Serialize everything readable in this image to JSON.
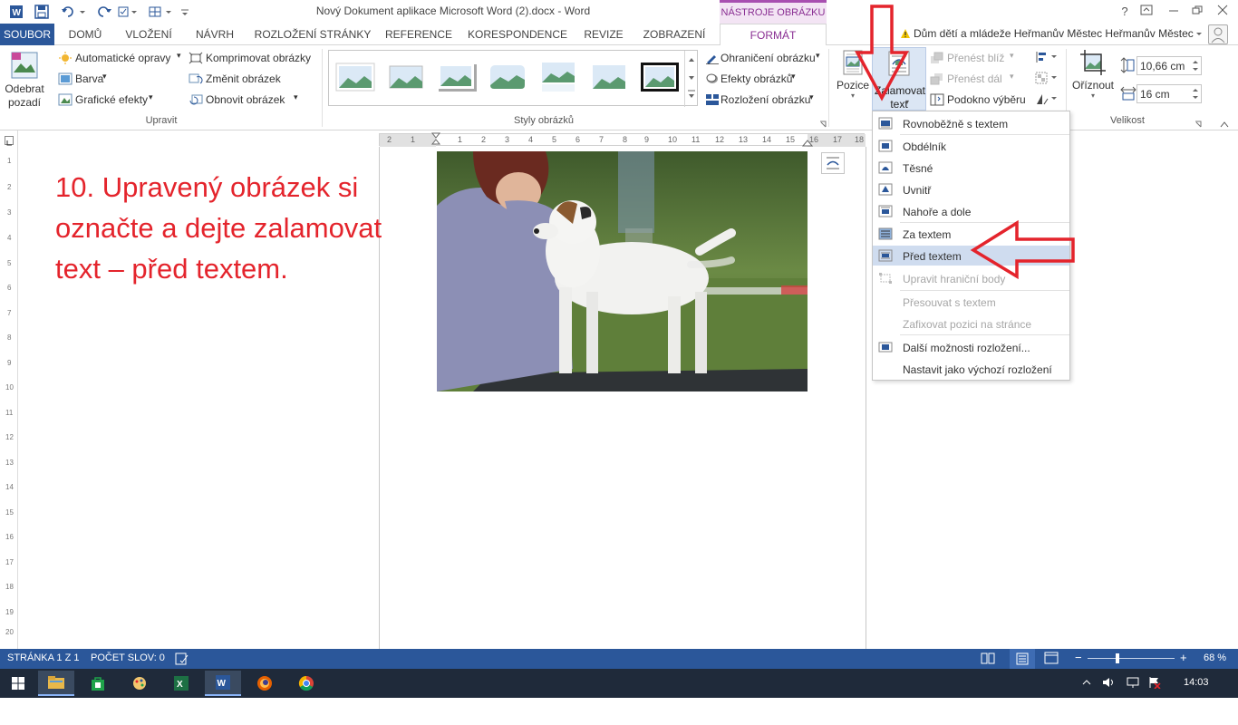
{
  "window": {
    "title": "Nový Dokument aplikace Microsoft Word (2).docx - Word",
    "context_tools": "NÁSTROJE OBRÁZKU",
    "help": "?",
    "user": "Dům dětí a mládeže Heřmanův Městec Heřmanův Městec"
  },
  "tabs": [
    "SOUBOR",
    "DOMŮ",
    "VLOŽENÍ",
    "NÁVRH",
    "ROZLOŽENÍ STRÁNKY",
    "REFERENCE",
    "KORESPONDENCE",
    "REVIZE",
    "ZOBRAZENÍ",
    "FORMÁT"
  ],
  "ribbon": {
    "remove_bg_1": "Odebrat",
    "remove_bg_2": "pozadí",
    "auto_corrections": "Automatické opravy",
    "color": "Barva",
    "artistic": "Grafické efekty",
    "compress": "Komprimovat obrázky",
    "change": "Změnit obrázek",
    "reset": "Obnovit obrázek",
    "group_adjust": "Upravit",
    "group_styles": "Styly obrázků",
    "border": "Ohraničení obrázku",
    "effects": "Efekty obrázků",
    "layout": "Rozložení obrázku",
    "position": "Pozice",
    "wrap_1": "Zalamovat",
    "wrap_2": "text",
    "forward": "Přenést blíž",
    "backward": "Přenést dál",
    "selection_pane": "Podokno výběru",
    "crop": "Oříznout",
    "height": "10,66 cm",
    "width": "16 cm",
    "group_size": "Velikost"
  },
  "ruler": [
    "2",
    "1",
    "1",
    "2",
    "3",
    "4",
    "5",
    "6",
    "7",
    "8",
    "9",
    "10",
    "11",
    "12",
    "13",
    "14",
    "15",
    "16",
    "17",
    "18"
  ],
  "document": {
    "instruction": "10. Upravený obrázek si označte a dejte zalamovat text – před textem."
  },
  "wrap_menu": {
    "items": [
      {
        "label": "Rovnoběžně s textem",
        "disabled": false,
        "selected": false
      },
      {
        "label": "Obdélník",
        "disabled": false,
        "selected": false
      },
      {
        "label": "Těsné",
        "disabled": false,
        "selected": false
      },
      {
        "label": "Uvnitř",
        "disabled": false,
        "selected": false
      },
      {
        "label": "Nahoře a dole",
        "disabled": false,
        "selected": false
      },
      {
        "label": "Za textem",
        "disabled": false,
        "selected": false
      },
      {
        "label": "Před textem",
        "disabled": false,
        "selected": true
      },
      {
        "label": "Upravit hraniční body",
        "disabled": true,
        "selected": false
      },
      {
        "label": "Přesouvat s textem",
        "disabled": true,
        "selected": false
      },
      {
        "label": "Zafixovat pozici na stránce",
        "disabled": true,
        "selected": false
      },
      {
        "label": "Další možnosti rozložení...",
        "disabled": false,
        "selected": false
      },
      {
        "label": "Nastavit jako výchozí rozložení",
        "disabled": false,
        "selected": false
      }
    ]
  },
  "status": {
    "page": "STRÁNKA 1 Z 1",
    "words": "POČET SLOV: 0",
    "zoom": "68 %"
  },
  "taskbar": {
    "clock": "14:03"
  },
  "colors": {
    "word_blue": "#2b579a",
    "format_purple": "#8a2f93",
    "annotation_red": "#e4242c"
  }
}
